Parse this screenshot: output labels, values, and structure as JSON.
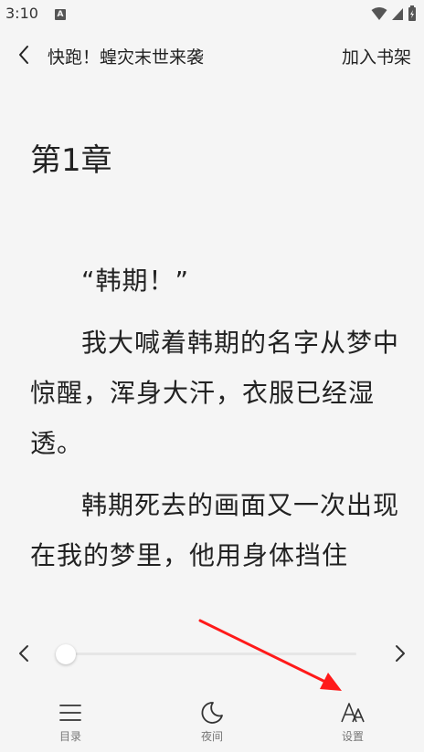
{
  "status_bar": {
    "time": "3:10",
    "notif_letter": "A",
    "icons": [
      "wifi-icon",
      "signal-icon",
      "battery-icon"
    ]
  },
  "header": {
    "back_icon": "chevron-left-icon",
    "book_title": "快跑！蝗灾末世来袭",
    "add_to_shelf": "加入书架"
  },
  "chapter": {
    "title": "第1章",
    "paragraphs": [
      "“韩期！”",
      "我大喊着韩期的名字从梦中惊醒，浑身大汗，衣服已经湿透。",
      "韩期死去的画面又一次出现在我的梦里，他用身体挡住"
    ]
  },
  "progress": {
    "prev_icon": "chevron-left-icon",
    "next_icon": "chevron-right-icon",
    "value": 0
  },
  "bottom_nav": {
    "items": [
      {
        "label": "目录",
        "icon": "menu-icon"
      },
      {
        "label": "夜间",
        "icon": "moon-icon"
      },
      {
        "label": "设置",
        "icon": "font-settings-icon"
      }
    ]
  },
  "colors": {
    "background": "#f5f5f5",
    "text": "#222222",
    "annotation_arrow": "#ff1a1a"
  }
}
